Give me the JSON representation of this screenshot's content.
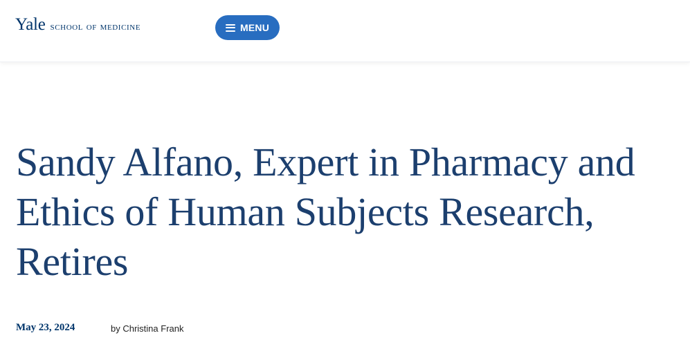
{
  "header": {
    "logo_yale": "Yale",
    "logo_school": "SCHOOL OF MEDICINE",
    "menu_label": "MENU",
    "menu_icon": "hamburger-icon"
  },
  "article": {
    "title": "Sandy Alfano, Expert in Pharmacy and Ethics of Human Subjects Research, Retires",
    "date": "May 23, 2024",
    "byline": "by Christina Frank"
  },
  "colors": {
    "brand_blue": "#00356b",
    "menu_button": "#286dc0",
    "title_text": "#1c3f6e"
  }
}
